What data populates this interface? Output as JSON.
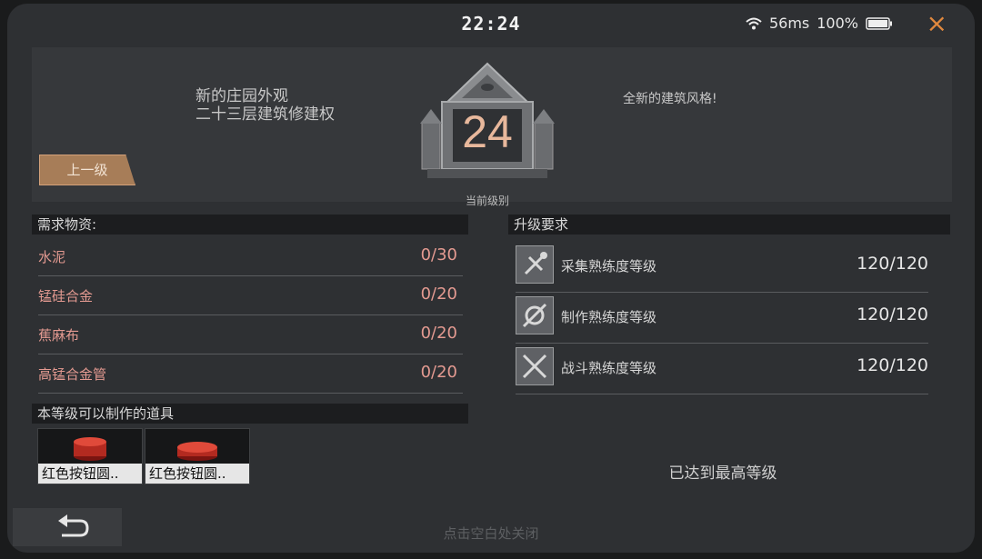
{
  "status_bar": {
    "time": "22:24",
    "ping": "56ms",
    "battery": "100%"
  },
  "close_icon": "×",
  "hero": {
    "title_line1": "新的庄园外观",
    "title_line2": "二十三层建筑修建权",
    "reward_text": "全新的建筑风格!",
    "prev_button": "上一级",
    "level": "24",
    "level_caption": "当前级别"
  },
  "materials": {
    "header": "需求物资:",
    "items": [
      {
        "name": "水泥",
        "value": "0/30"
      },
      {
        "name": "锰硅合金",
        "value": "0/20"
      },
      {
        "name": "蕉麻布",
        "value": "0/20"
      },
      {
        "name": "高锰合金管",
        "value": "0/20"
      }
    ]
  },
  "craftable": {
    "header": "本等级可以制作的道具",
    "items": [
      {
        "label": "红色按钮圆.."
      },
      {
        "label": "红色按钮圆.."
      }
    ]
  },
  "requirements": {
    "header": "升级要求",
    "items": [
      {
        "name": "采集熟练度等级",
        "value": "120/120",
        "icon": "gather-icon"
      },
      {
        "name": "制作熟练度等级",
        "value": "120/120",
        "icon": "craft-icon"
      },
      {
        "name": "战斗熟练度等级",
        "value": "120/120",
        "icon": "combat-icon"
      }
    ],
    "max_text": "已达到最高等级"
  },
  "footer": {
    "hint": "点击空白处关闭",
    "back_icon": "back-arrow-icon"
  },
  "colors": {
    "accent": "#e0883e",
    "material_red": "#e49a91",
    "level_digits": "#e8b89c"
  }
}
